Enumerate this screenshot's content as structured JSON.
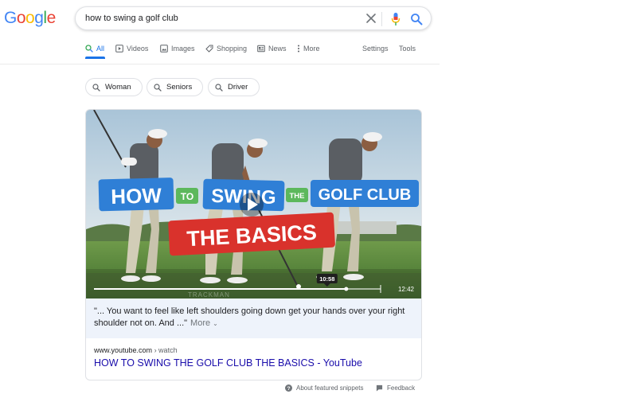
{
  "logo": {
    "letters": [
      "G",
      "o",
      "o",
      "g",
      "l",
      "e"
    ],
    "colors": [
      "#4285f4",
      "#ea4335",
      "#fbbc05",
      "#4285f4",
      "#34a853",
      "#ea4335"
    ]
  },
  "search": {
    "query": "how to swing a golf club"
  },
  "nav": {
    "all": "All",
    "videos": "Videos",
    "images": "Images",
    "shopping": "Shopping",
    "news": "News",
    "more": "More",
    "settings": "Settings",
    "tools": "Tools"
  },
  "chips": [
    "Woman",
    "Seniors",
    "Driver"
  ],
  "video": {
    "title_how": "HOW",
    "title_to": "TO",
    "title_swing": "SWING",
    "title_the": "THE",
    "title_golf_club": "GOLF CLUB",
    "title_basics": "THE BASICS",
    "watermark": "TRACKMAN",
    "hover_time": "10:58",
    "duration": "12:42",
    "progress": 0.88
  },
  "snippet": {
    "transcript": "\"... You want to feel like left shoulders going down get your hands over your right shoulder not on. And ...\"",
    "more": "More"
  },
  "result": {
    "domain": "www.youtube.com",
    "crumb": "› watch",
    "title": "HOW TO SWING THE GOLF CLUB THE BASICS - YouTube"
  },
  "footer": {
    "about": "About featured snippets",
    "feedback": "Feedback"
  },
  "colors": {
    "link": "#1a0dab",
    "accent": "#1a73e8",
    "title_blue": "#2f7fd6",
    "title_green": "#5cb85c",
    "title_red": "#d9322c"
  }
}
